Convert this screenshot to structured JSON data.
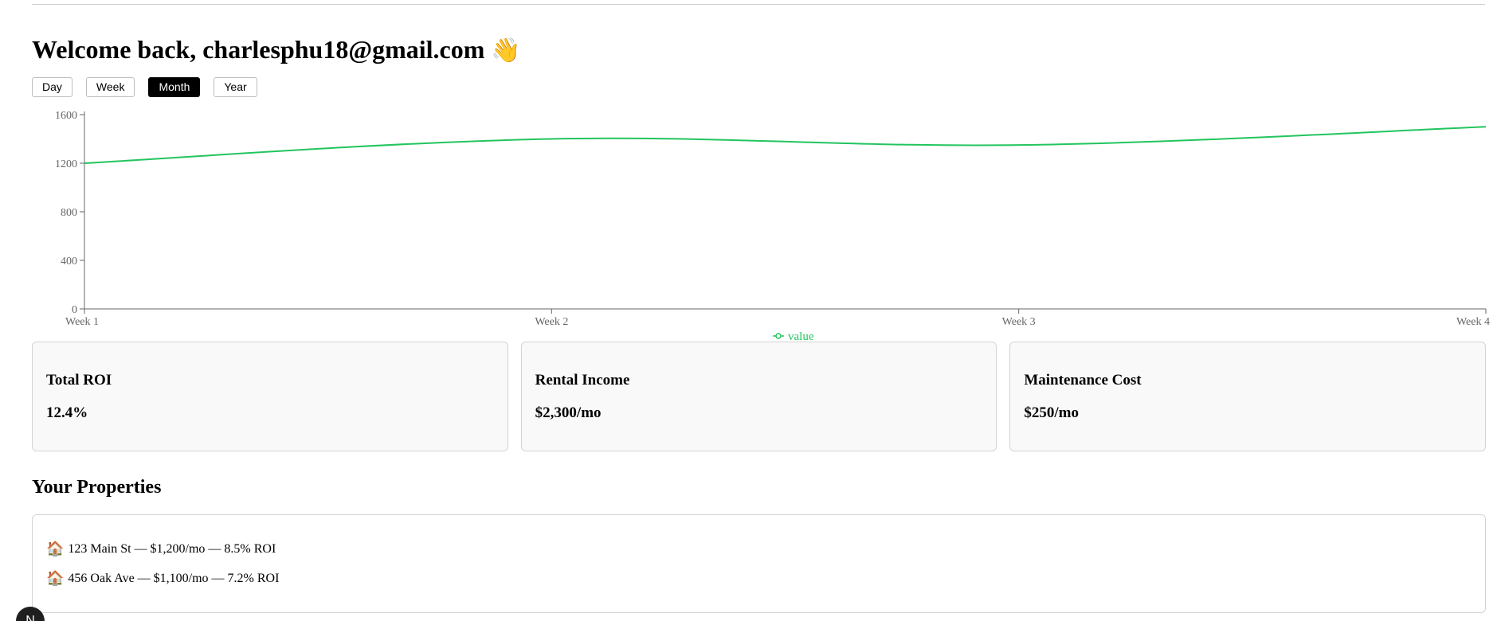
{
  "header": {
    "welcome_text": "Welcome back, charlesphu18@gmail.com",
    "wave_emoji": "👋"
  },
  "range_selector": {
    "options": [
      "Day",
      "Week",
      "Month",
      "Year"
    ],
    "selected": "Month"
  },
  "chart_data": {
    "type": "line",
    "categories": [
      "Week 1",
      "Week 2",
      "Week 3",
      "Week 4"
    ],
    "series": [
      {
        "name": "value",
        "values": [
          1200,
          1400,
          1350,
          1500
        ],
        "color": "#22c55e"
      }
    ],
    "ylim": [
      0,
      1600
    ],
    "yticks": [
      0,
      400,
      800,
      1200,
      1600
    ],
    "legend": "value",
    "legend_position": "bottom-center",
    "grid": false
  },
  "stats": [
    {
      "title": "Total ROI",
      "value": "12.4%"
    },
    {
      "title": "Rental Income",
      "value": "$2,300/mo"
    },
    {
      "title": "Maintenance Cost",
      "value": "$250/mo"
    }
  ],
  "properties": {
    "title": "Your Properties",
    "items": [
      {
        "icon": "house-icon",
        "text": "123 Main St — $1,200/mo — 8.5% ROI"
      },
      {
        "icon": "house-icon",
        "text": "456 Oak Ave — $1,100/mo — 7.2% ROI"
      }
    ]
  },
  "avatar": {
    "initial": "N"
  },
  "colors": {
    "accent": "#22c55e",
    "active_button": "#000000",
    "card_bg": "#f9f9f9",
    "border": "#d4d4d4"
  }
}
